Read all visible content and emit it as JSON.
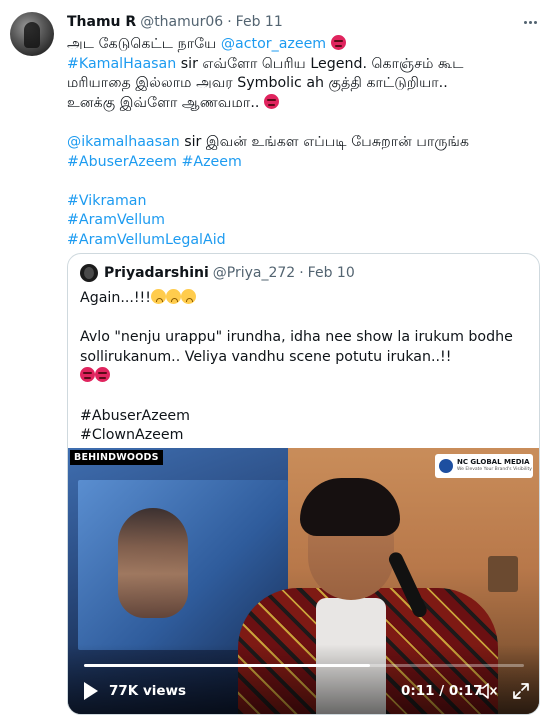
{
  "author": {
    "name": "Thamu R",
    "handle": "@thamur06",
    "date": "Feb 11"
  },
  "tweet": {
    "l1_text": "அட கேடுகெட்ட நாயே ",
    "l1_mention": "@actor_azeem",
    "l2_hashtag": "#KamalHaasan",
    "l2_text": " sir எவ்ளோ பெரிய Legend. கொஞ்சம் கூட",
    "l3_text": "மரியாதை இல்லாம அவர Symbolic ah குத்தி காட்டுறியா..",
    "l4_text": "உனக்கு இவ்ளோ ஆணவமா.. ",
    "l6_mention": "@ikamalhaasan",
    "l6_text": " sir இவன் உங்கள எப்படி பேசுறான் பாருங்க",
    "l7_hashtag1": "#AbuserAzeem",
    "l7_hashtag2": "#Azeem",
    "l9_hashtag": "#Vikraman",
    "l10_hashtag": "#AramVellum",
    "l11_hashtag": "#AramVellumLegalAid"
  },
  "quote": {
    "name": "Priyadarshini",
    "handle": "@Priya_272",
    "date": "Feb 10",
    "l1_text": "Again...!!!",
    "l2_text": "Avlo \"nenju urappu\" irundha, idha nee show la irukum bodhe",
    "l3_text": "sollirukanum.. Veliya vandhu scene potutu irukan..!!",
    "l5_hashtag": "#AbuserAzeem",
    "l6_hashtag": "#ClownAzeem"
  },
  "video": {
    "watermark_left": "BEHINDWOODS",
    "watermark_right_title": "NC GLOBAL MEDIA",
    "watermark_right_sub": "We Elevate Your Brand's Visibility",
    "views": "77K views",
    "time": "0:11 / 0:17",
    "progress": 0.65
  },
  "icons": {
    "more": "more-horizontal-icon",
    "play": "play-icon",
    "mute": "volume-muted-icon",
    "fullscreen": "fullscreen-icon",
    "angry": "angry-face-emoji",
    "worried": "worried-face-emoji"
  },
  "colors": {
    "link": "#1d9bf0",
    "secondary_text": "#536471",
    "border": "#cfd9de",
    "emoji_angry": "#e0245e"
  }
}
